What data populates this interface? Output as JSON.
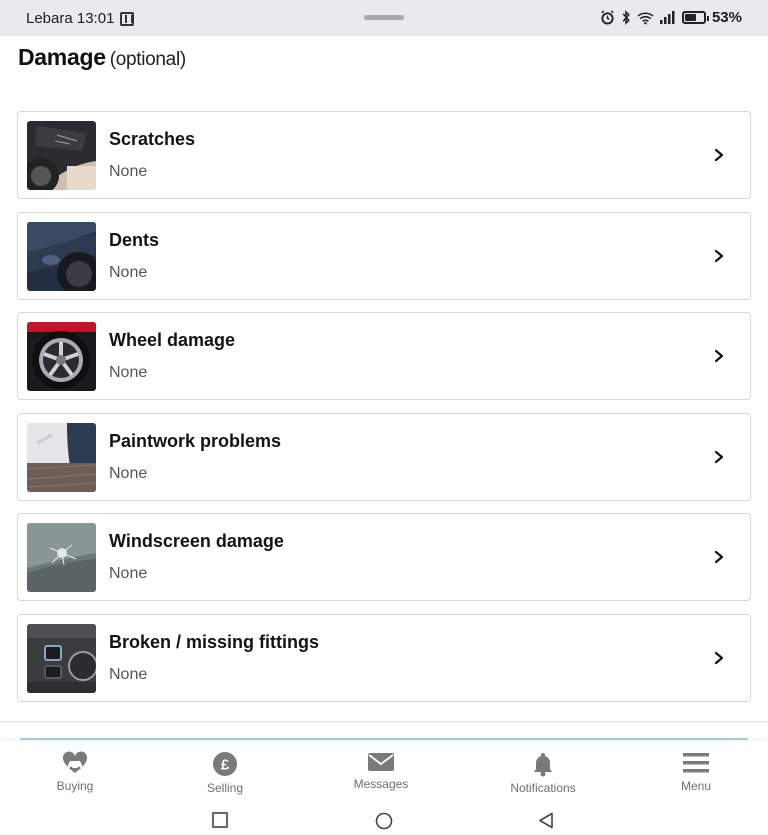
{
  "status_bar": {
    "carrier_time": "Lebara 13:01",
    "battery_percent": "53%",
    "battery_level": 0.53,
    "icons": [
      "nfc-icon",
      "alarm-icon",
      "bluetooth-icon",
      "wifi-icon",
      "signal-icon",
      "battery-icon"
    ]
  },
  "header": {
    "title": "Damage",
    "subtitle": "(optional)"
  },
  "damage_items": [
    {
      "title": "Scratches",
      "value": "None"
    },
    {
      "title": "Dents",
      "value": "None"
    },
    {
      "title": "Wheel damage",
      "value": "None"
    },
    {
      "title": "Paintwork problems",
      "value": "None"
    },
    {
      "title": "Windscreen damage",
      "value": "None"
    },
    {
      "title": "Broken / missing fittings",
      "value": "None"
    }
  ],
  "bottom_nav": {
    "buying": "Buying",
    "selling": "Selling",
    "messages": "Messages",
    "notifications": "Notifications",
    "menu": "Menu"
  },
  "colors": {
    "accent_line": "#9fd8d5",
    "nav_icon": "#7a7a7a"
  }
}
